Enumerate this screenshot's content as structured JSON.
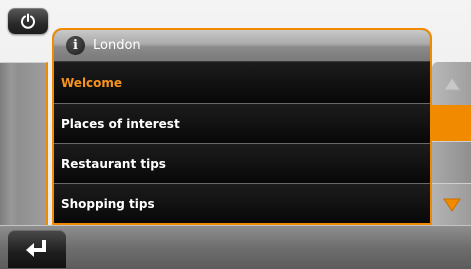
{
  "power": {
    "icon": "power-icon"
  },
  "dialog": {
    "icon": "info-icon",
    "icon_glyph": "i",
    "title": "London",
    "items": [
      {
        "label": "Welcome",
        "selected": true
      },
      {
        "label": "Places of interest",
        "selected": false
      },
      {
        "label": "Restaurant tips",
        "selected": false
      },
      {
        "label": "Shopping tips",
        "selected": false
      }
    ]
  },
  "scroll": {
    "up_icon": "triangle-up-icon",
    "down_icon": "triangle-down-icon",
    "up_enabled": false,
    "down_enabled": true,
    "position_fraction": 0.5
  },
  "bottom_bar": {
    "back_icon": "return-arrow-icon"
  },
  "colors": {
    "accent": "#f28a00",
    "selected_text": "#f7941d",
    "item_text": "#ffffff",
    "list_bg": "#0a0a0a"
  }
}
